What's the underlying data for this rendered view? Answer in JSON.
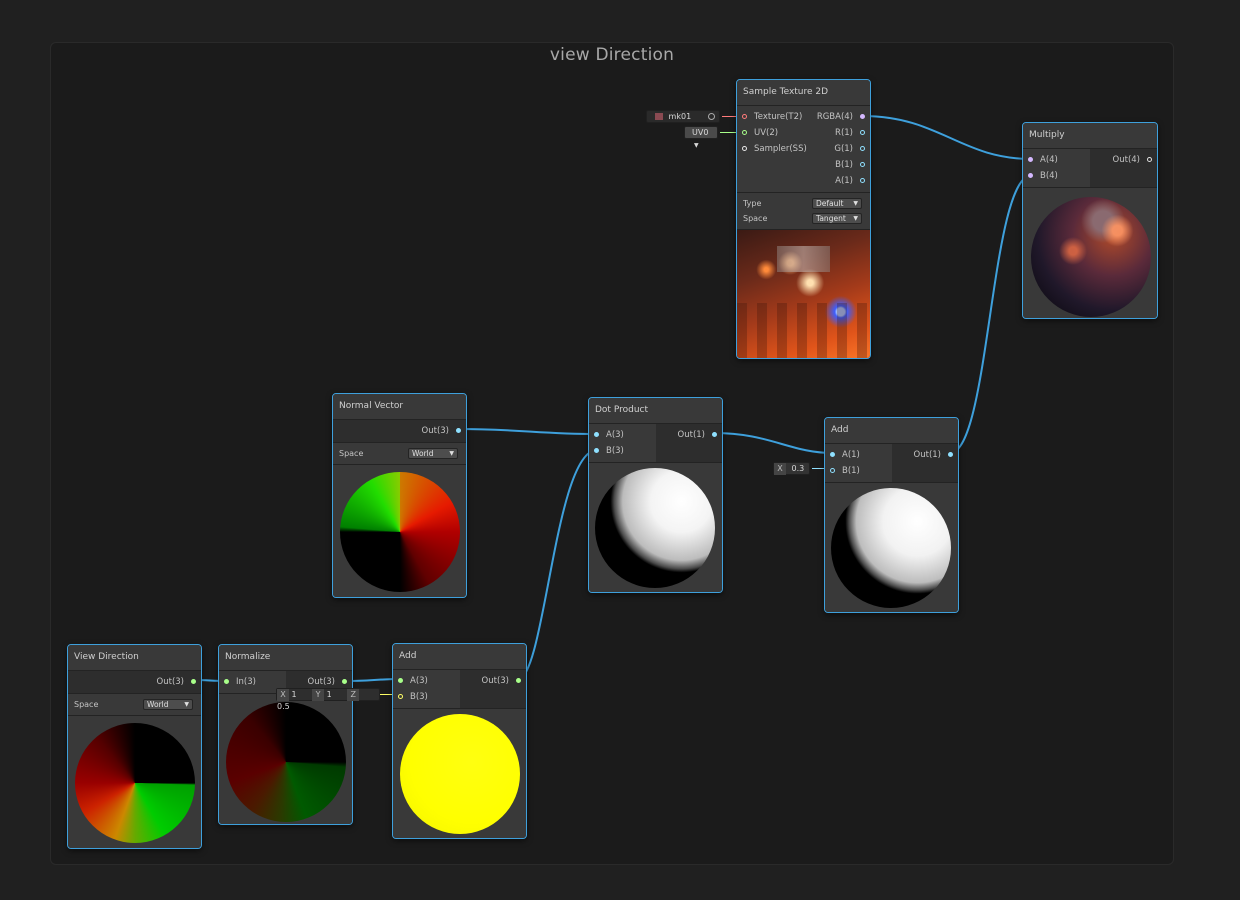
{
  "group": {
    "title": "view Direction"
  },
  "nodes": {
    "view_direction": {
      "title": "View Direction",
      "out_label": "Out(3)",
      "space_label": "Space",
      "space_value": "World"
    },
    "normalize": {
      "title": "Normalize",
      "in_label": "In(3)",
      "out_label": "Out(3)"
    },
    "add_vec": {
      "title": "Add",
      "a_label": "A(3)",
      "b_label": "B(3)",
      "out_label": "Out(3)",
      "b_default": {
        "x_label": "X",
        "x": "1",
        "y_label": "Y",
        "y": "1",
        "z_label": "Z",
        "z": "0.5"
      }
    },
    "normal_vector": {
      "title": "Normal Vector",
      "out_label": "Out(3)",
      "space_label": "Space",
      "space_value": "World"
    },
    "dot_product": {
      "title": "Dot Product",
      "a_label": "A(3)",
      "b_label": "B(3)",
      "out_label": "Out(1)"
    },
    "add_scalar": {
      "title": "Add",
      "a_label": "A(1)",
      "b_label": "B(1)",
      "out_label": "Out(1)",
      "b_default": {
        "x_label": "X",
        "x": "0.3"
      }
    },
    "sample_texture": {
      "title": "Sample Texture 2D",
      "inputs": [
        "Texture(T2)",
        "UV(2)",
        "Sampler(SS)"
      ],
      "outputs": [
        "RGBA(4)",
        "R(1)",
        "G(1)",
        "B(1)",
        "A(1)"
      ],
      "type_label": "Type",
      "type_value": "Default",
      "space_label": "Space",
      "space_value": "Tangent",
      "texture_default": "mk01",
      "uv_default": "UV0"
    },
    "multiply": {
      "title": "Multiply",
      "a_label": "A(4)",
      "b_label": "B(4)",
      "out_label": "Out(4)"
    }
  },
  "colors": {
    "node_border": "#3ea0dc",
    "wire": "#3ea0dc",
    "port_vector": "#8fe0ff",
    "port_texture": "#ff7b7b",
    "port_uv": "#a8ff8a",
    "port_vec4": "#d4b8ff"
  },
  "icons": [
    "texture-thumbnail-icon",
    "object-picker-icon",
    "dropdown-arrow-icon"
  ]
}
